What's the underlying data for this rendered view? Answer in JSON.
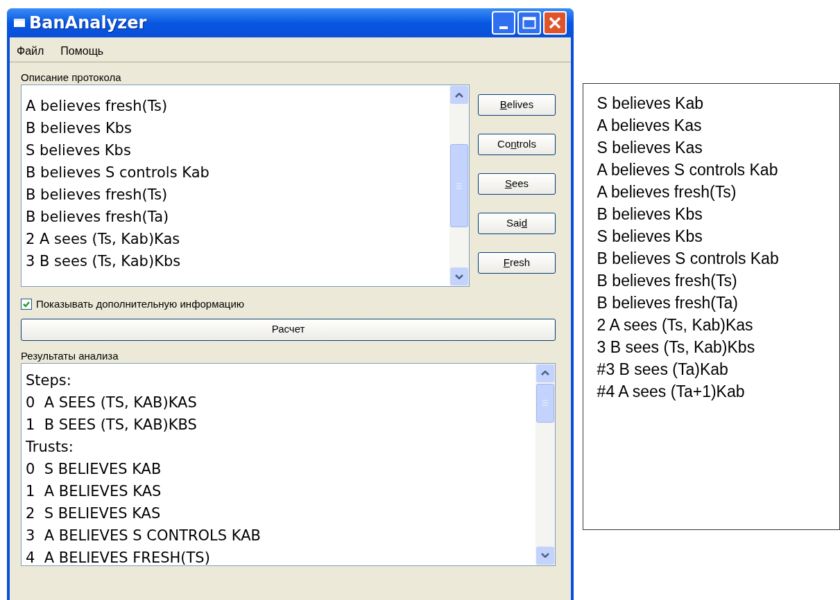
{
  "window": {
    "title": "BanAnalyzer"
  },
  "menu": [
    "Файл",
    "Помощь"
  ],
  "protocol": {
    "label": "Описание протокола",
    "items": [
      "A believes fresh(Ts)",
      "B believes Kbs",
      "S believes Kbs",
      "B believes S controls Kab",
      "B believes fresh(Ts)",
      "B believes fresh(Ta)",
      "2 A sees (Ts, Kab)Kas",
      "3 B sees (Ts, Kab)Kbs"
    ]
  },
  "buttons": [
    {
      "segments": [
        {
          "text": "B",
          "underlined": true
        },
        {
          "text": "elives",
          "underlined": false
        }
      ]
    },
    {
      "segments": [
        {
          "text": "Co",
          "underlined": false
        },
        {
          "text": "n",
          "underlined": true
        },
        {
          "text": "trols",
          "underlined": false
        }
      ]
    },
    {
      "segments": [
        {
          "text": "S",
          "underlined": true
        },
        {
          "text": "ees",
          "underlined": false
        }
      ]
    },
    {
      "segments": [
        {
          "text": "Sai",
          "underlined": false
        },
        {
          "text": "d",
          "underlined": true
        }
      ]
    },
    {
      "segments": [
        {
          "text": "F",
          "underlined": true
        },
        {
          "text": "resh",
          "underlined": false
        }
      ]
    }
  ],
  "checkbox": {
    "label": "Показывать дополнительную информацию",
    "checked": true
  },
  "compute_button": "Расчет",
  "results": {
    "label": "Результаты анализа",
    "lines": [
      "Steps:",
      "0  A SEES (TS, KAB)KAS",
      "1  B SEES (TS, KAB)KBS",
      "Trusts:",
      "0  S BELIEVES KAB",
      "1  A BELIEVES KAS",
      "2  S BELIEVES KAS",
      "3  A BELIEVES S CONTROLS KAB",
      "4  A BELIEVES FRESH(TS)"
    ]
  },
  "side_panel": [
    "S believes Kab",
    "A believes Kas",
    "S believes Kas",
    "A believes S controls Kab",
    "A believes fresh(Ts)",
    "B believes Kbs",
    "S believes Kbs",
    "B believes S controls Kab",
    "B believes fresh(Ts)",
    "B believes fresh(Ta)",
    "2 A sees (Ts, Kab)Kas",
    "3 B sees (Ts, Kab)Kbs",
    "#3 B sees (Ta)Kab",
    "#4 A sees (Ta+1)Kab"
  ]
}
